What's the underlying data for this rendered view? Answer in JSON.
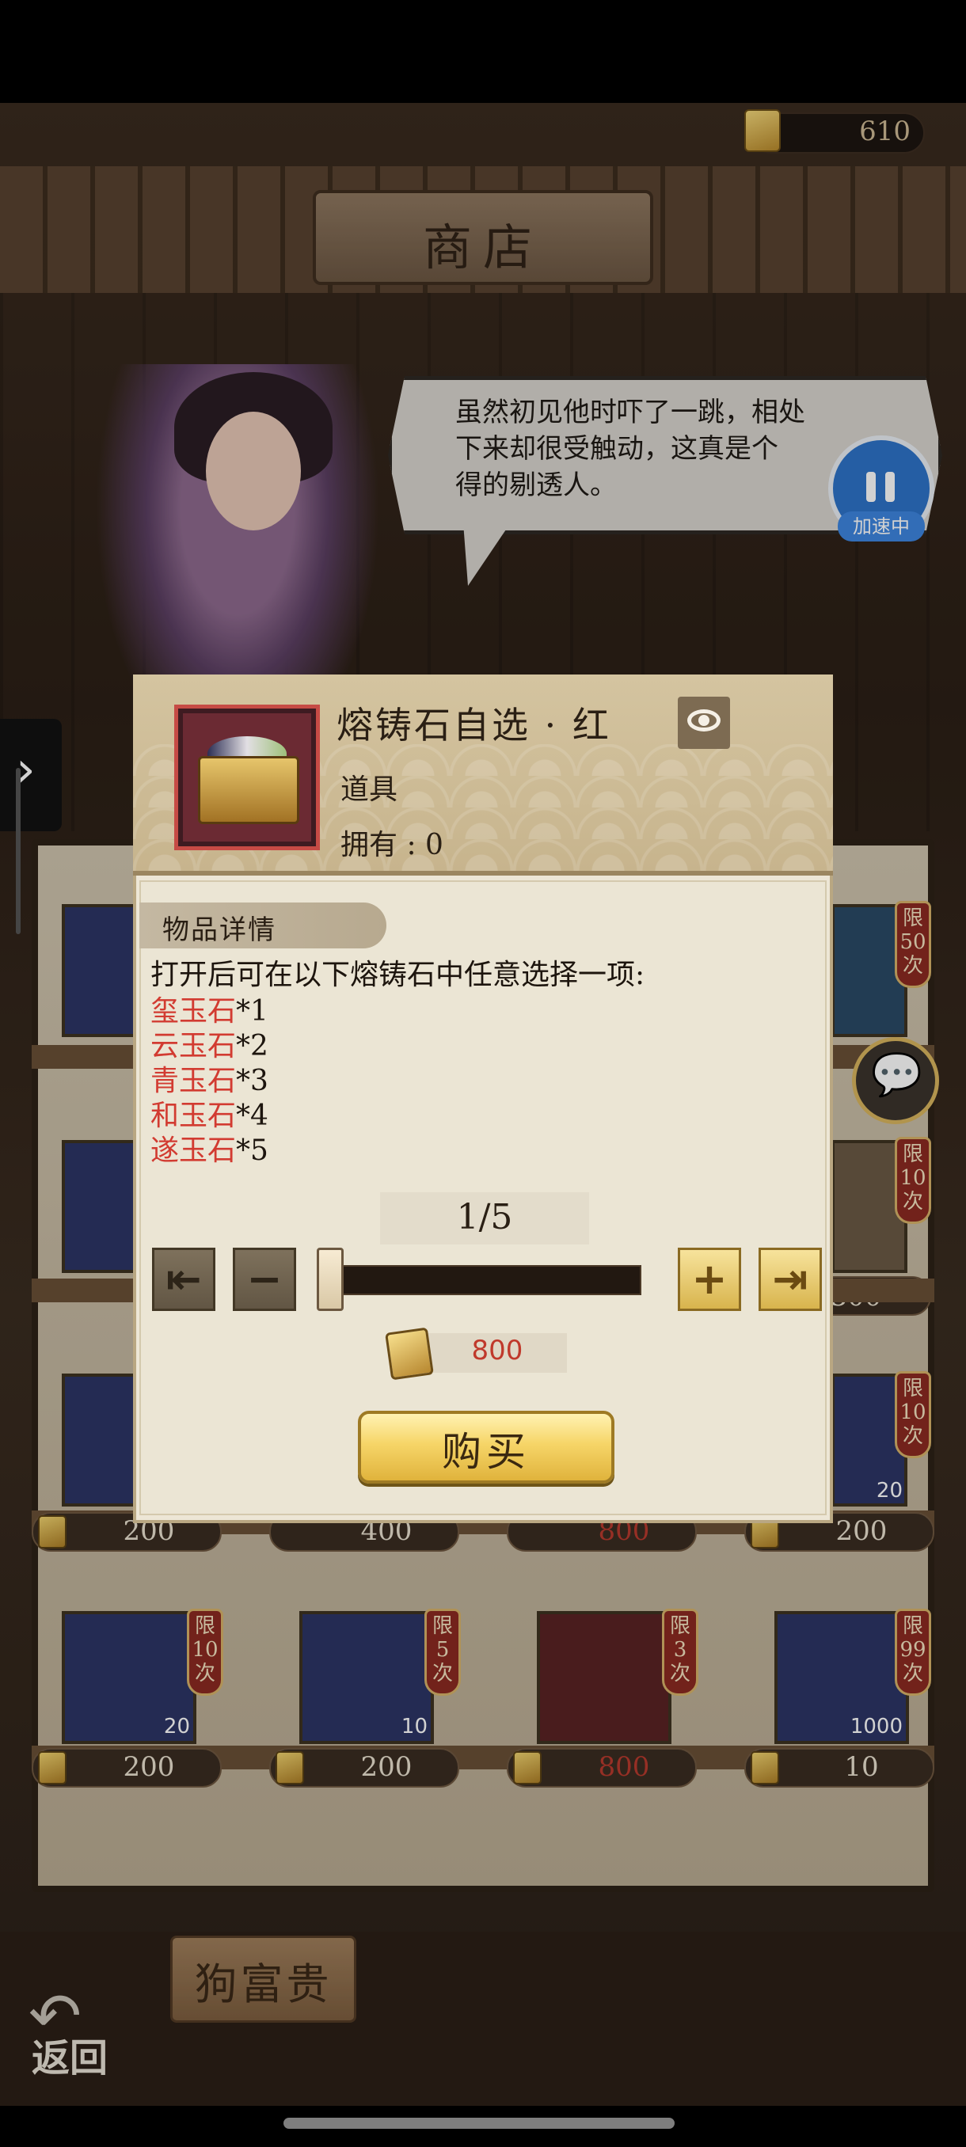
{
  "header": {
    "currency_value": "610",
    "shop_title": "商店"
  },
  "npc": {
    "speech": "虽然初见他时吓了一跳，相处\n下来却很受触动，这真是个\n得的剔透人。"
  },
  "speed_button": {
    "label": "加速中"
  },
  "shop_grid": {
    "row2": [
      {
        "price": "200"
      },
      {
        "price": "400"
      },
      {
        "price": "800"
      },
      {
        "price": "200",
        "limit": "限10次",
        "qty": "20"
      }
    ],
    "row3": [
      {
        "price": "200",
        "limit": "限10次",
        "qty": "20"
      },
      {
        "price": "200",
        "limit": "限5次",
        "qty": "10"
      },
      {
        "price": "800",
        "limit": "限3次"
      },
      {
        "price": "10",
        "limit": "限99次",
        "qty": "1000"
      }
    ],
    "right_col": [
      {
        "limit": "限50次"
      },
      {
        "limit": "限10次",
        "price": "300"
      }
    ]
  },
  "footer": {
    "shop_owner_name": "狗富贵",
    "back_label": "返回"
  },
  "modal": {
    "item_name": "熔铸石自选 · 红",
    "item_type": "道具",
    "owned_label": "拥有 : 0",
    "tab_label": "物品详情",
    "description": "打开后可在以下熔铸石中任意选择一项:",
    "rewards": [
      {
        "name": "玺玉石",
        "count": "*1"
      },
      {
        "name": "云玉石",
        "count": "*2"
      },
      {
        "name": "青玉石",
        "count": "*3"
      },
      {
        "name": "和玉石",
        "count": "*4"
      },
      {
        "name": "遂玉石",
        "count": "*5"
      }
    ],
    "quantity_display": "1/5",
    "quantity_fraction": 0.2,
    "cost": "800",
    "buy_label": "购买"
  },
  "colors": {
    "reward_red": "#d23b31",
    "gold": "#f6d568",
    "speed_blue": "#2e73c8"
  }
}
